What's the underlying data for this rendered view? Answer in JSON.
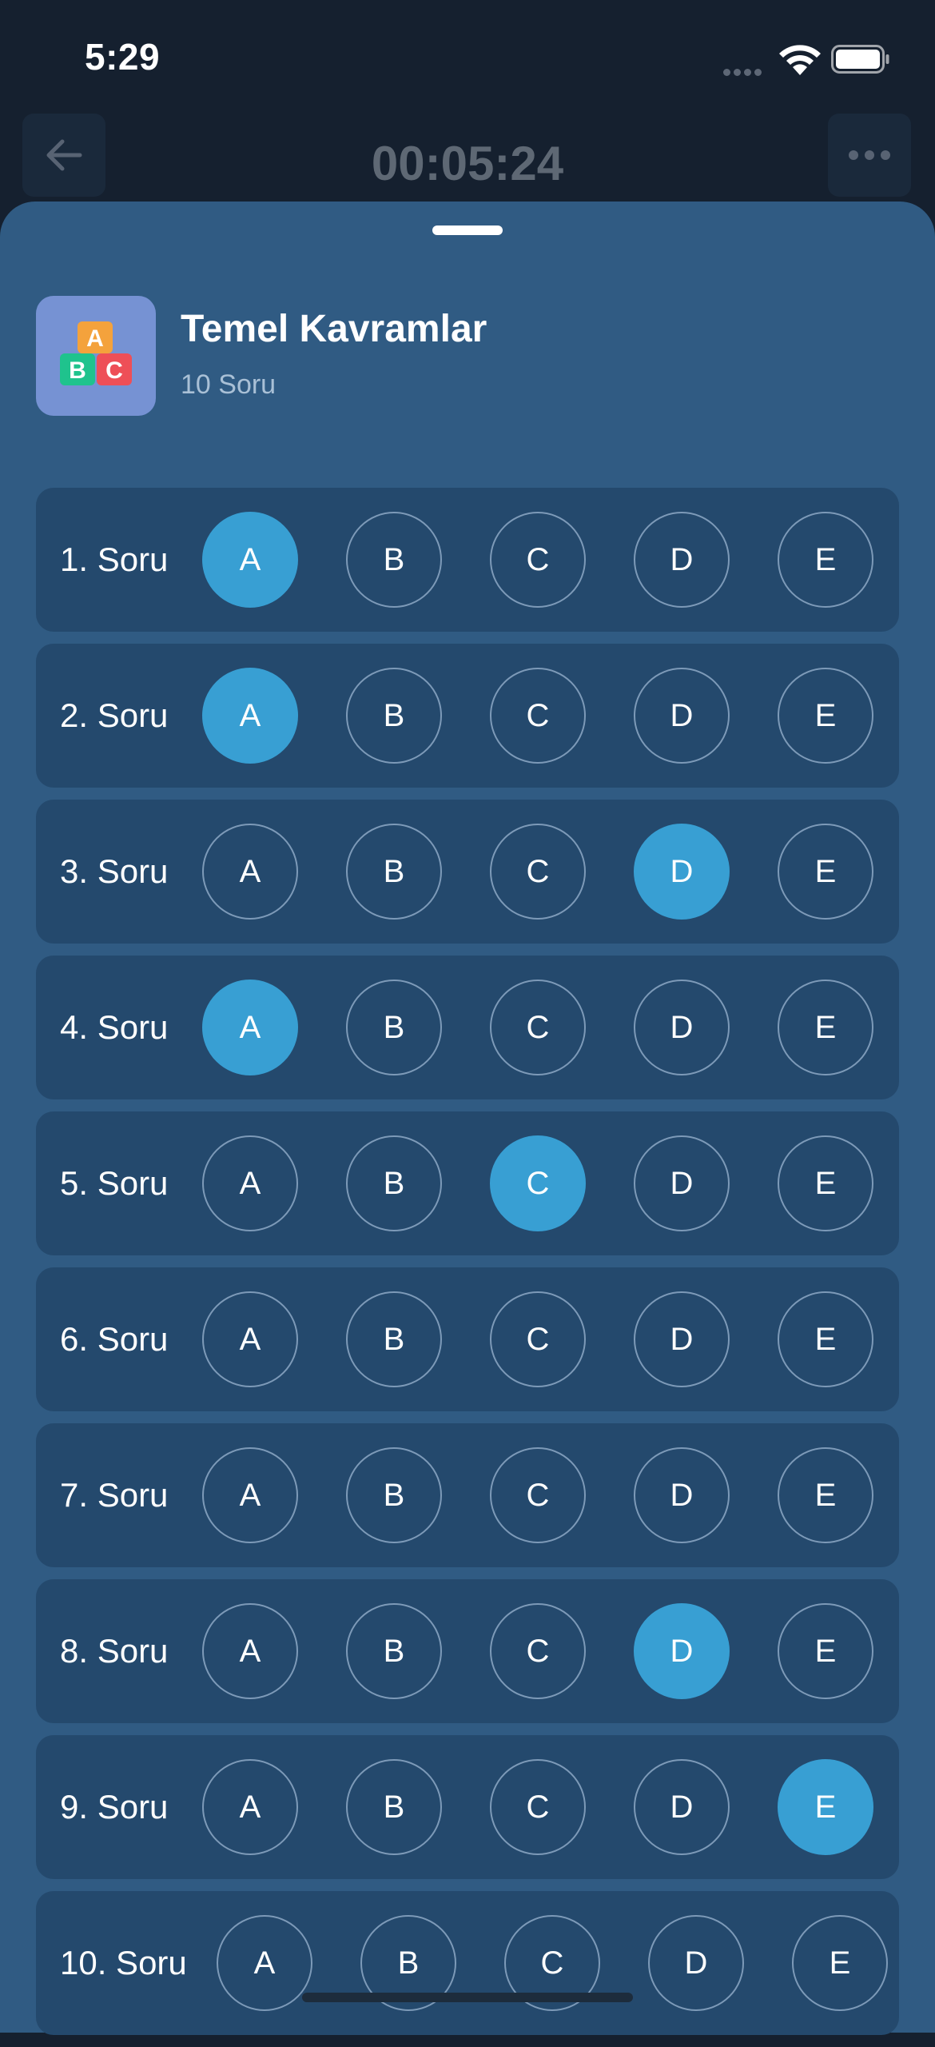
{
  "status": {
    "time": "5:29"
  },
  "header": {
    "timer": "00:05:24"
  },
  "quiz": {
    "title": "Temel Kavramlar",
    "subtitle": "10 Soru",
    "icon_letters": [
      "A",
      "B",
      "C"
    ]
  },
  "colors": {
    "selected": "#389fd3",
    "sheet": "#305b83",
    "row": "#24496d"
  },
  "questions": [
    {
      "label": "1. Soru",
      "options": [
        "A",
        "B",
        "C",
        "D",
        "E"
      ],
      "selected": "A"
    },
    {
      "label": "2. Soru",
      "options": [
        "A",
        "B",
        "C",
        "D",
        "E"
      ],
      "selected": "A"
    },
    {
      "label": "3. Soru",
      "options": [
        "A",
        "B",
        "C",
        "D",
        "E"
      ],
      "selected": "D"
    },
    {
      "label": "4. Soru",
      "options": [
        "A",
        "B",
        "C",
        "D",
        "E"
      ],
      "selected": "A"
    },
    {
      "label": "5. Soru",
      "options": [
        "A",
        "B",
        "C",
        "D",
        "E"
      ],
      "selected": "C"
    },
    {
      "label": "6. Soru",
      "options": [
        "A",
        "B",
        "C",
        "D",
        "E"
      ],
      "selected": null
    },
    {
      "label": "7. Soru",
      "options": [
        "A",
        "B",
        "C",
        "D",
        "E"
      ],
      "selected": null
    },
    {
      "label": "8. Soru",
      "options": [
        "A",
        "B",
        "C",
        "D",
        "E"
      ],
      "selected": "D"
    },
    {
      "label": "9. Soru",
      "options": [
        "A",
        "B",
        "C",
        "D",
        "E"
      ],
      "selected": "E"
    },
    {
      "label": "10. Soru",
      "options": [
        "A",
        "B",
        "C",
        "D",
        "E"
      ],
      "selected": null
    }
  ]
}
